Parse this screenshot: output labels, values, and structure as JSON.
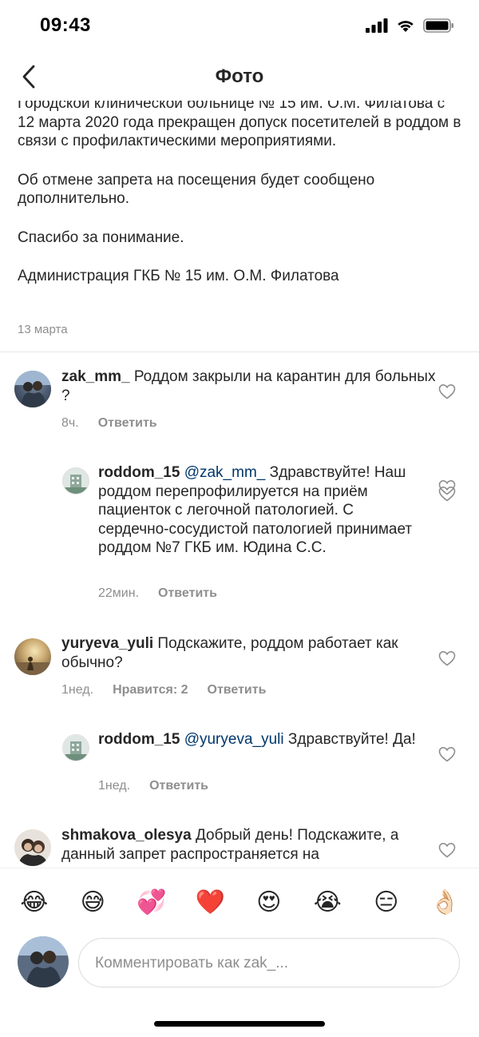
{
  "status_bar": {
    "time": "09:43"
  },
  "nav": {
    "title": "Фото"
  },
  "caption": {
    "paragraphs": [
      "Городской клинической больнице № 15 им. О.М. Филатова с 12 марта 2020 года прекращен допуск посетителей в роддом в связи с профилактическими мероприятиями.",
      "Об отмене запрета на посещения будет сообщено дополнительно.",
      "Спасибо за понимание.",
      "Администрация ГКБ № 15 им. О.М. Филатова"
    ],
    "date": "13 марта"
  },
  "comments": [
    {
      "username": "zak_mm_",
      "text": "Роддом закрыли на карантин для больных ?",
      "time": "8ч.",
      "reply_label": "Ответить"
    },
    {
      "username": "roddom_15",
      "mention": "@zak_mm_",
      "text": "Здравствуйте! Наш роддом перепрофилируется на приём пациенток с легочной патологией. С сердечно-сосудистой патологией принимает роддом №7 ГКБ им. Юдина С.С.",
      "time": "22мин.",
      "reply_label": "Ответить"
    },
    {
      "username": "yuryeva_yuli",
      "text": "Подскажите, роддом работает как обычно?",
      "time": "1нед.",
      "likes_label": "Нравится: 2",
      "reply_label": "Ответить"
    },
    {
      "username": "roddom_15",
      "mention": "@yuryeva_yuli",
      "text": "Здравствуйте! Да!",
      "time": "1нед.",
      "reply_label": "Ответить"
    },
    {
      "username": "shmakova_olesya",
      "text": "Добрый день! Подскажите, а данный запрет распространяется на"
    }
  ],
  "emoji_bar": [
    "😂",
    "😅",
    "💞",
    "❤️",
    "😍",
    "😭",
    "😑",
    "👌🏻"
  ],
  "comment_input": {
    "placeholder": "Комментировать как zak_..."
  },
  "colors": {
    "link": "#00376b",
    "secondary": "#8e8e8e",
    "text": "#262626",
    "heart_red": "#ed4956"
  }
}
